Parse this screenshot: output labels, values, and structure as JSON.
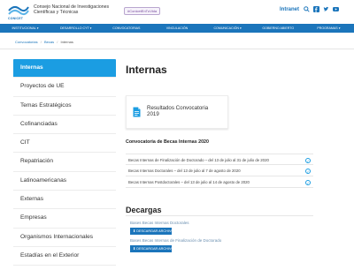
{
  "header": {
    "logo_text": "CONICET",
    "org_line1": "Consejo Nacional de Investigaciones",
    "org_line2": "Científicas y Técnicas",
    "hashtag": "#ConicetEnTuVida",
    "intranet": "Intranet",
    "icons": [
      "search-icon",
      "facebook-icon",
      "twitter-icon",
      "youtube-icon"
    ]
  },
  "nav": {
    "items": [
      "INSTITUCIONAL ▾",
      "DESARROLLO CYT ▾",
      "CONVOCATORIAS",
      "VINCULACIÓN",
      "COMUNICACIÓN ▾",
      "GOBIERNO ABIERTO",
      "PROGRAMAS ▾"
    ]
  },
  "breadcrumb": {
    "items": [
      "Convocatorias",
      "Becas",
      "Internas"
    ],
    "separator": "/"
  },
  "sidebar": {
    "active_index": 0,
    "items": [
      "Internas",
      "Proyectos de UE",
      "Temas Estratégicos",
      "Cofinanciadas",
      "CIT",
      "Repatriación",
      "Latinoamericanas",
      "Externas",
      "Empresas",
      "Organismos Internacionales",
      "Estadías en el Exterior"
    ]
  },
  "main": {
    "title": "Internas",
    "card": {
      "line1": "Resultados Convocatoria",
      "line2": "2019",
      "icon": "document-icon"
    },
    "convocatoria": {
      "title": "Convocatoria de Becas Internas 2020",
      "rows": [
        "Becas Internas de Finalización de Doctorado – del 13 de julio al 31 de julio de 2020",
        "Becas Internas Doctorales – del 13 de julio al 7 de agosto de 2020",
        "Becas Internas Postdoctorales – del 13 de julio al 14 de agosto de 2020"
      ]
    },
    "descargas": {
      "title": "Decargas",
      "items": [
        {
          "name": "Bases Becas Internas Doctorales",
          "button": "⬇ DESCARGAR ARCHIVO"
        },
        {
          "name": "Bases Becas Internas de Finalización de Doctorado",
          "button": "⬇ DESCARGAR ARCHIVO"
        }
      ]
    }
  },
  "colors": {
    "brand_blue": "#1b75bb",
    "active_blue": "#1b9de2"
  }
}
